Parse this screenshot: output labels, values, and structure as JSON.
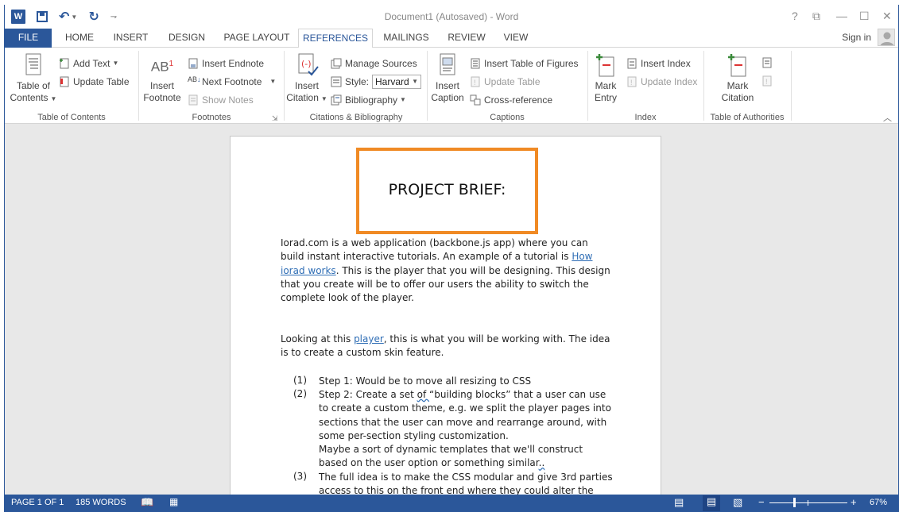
{
  "window": {
    "title": "Document1 (Autosaved) - Word",
    "help": "?",
    "controls": [
      "⧉",
      "—",
      "☐",
      "✕"
    ]
  },
  "qat": {
    "app_icon": "word-icon",
    "save": "save-icon",
    "undo": "undo-icon",
    "redo": "redo-icon",
    "customize": "⇁"
  },
  "tabs": [
    "FILE",
    "HOME",
    "INSERT",
    "DESIGN",
    "PAGE LAYOUT",
    "REFERENCES",
    "MAILINGS",
    "REVIEW",
    "VIEW"
  ],
  "active_tab": "REFERENCES",
  "account": {
    "sign_in": "Sign in"
  },
  "ribbon": {
    "toc": {
      "group": "Table of Contents",
      "toc_line1": "Table of",
      "toc_line2": "Contents",
      "add_text": "Add Text",
      "update_table": "Update Table"
    },
    "footnotes": {
      "group": "Footnotes",
      "insert_footnote_line1": "Insert",
      "insert_footnote_line2": "Footnote",
      "insert_endnote": "Insert Endnote",
      "next_footnote": "Next Footnote",
      "show_notes": "Show Notes",
      "ab_label": "AB",
      "ab_sup": "1"
    },
    "citations": {
      "group": "Citations & Bibliography",
      "insert_citation_line1": "Insert",
      "insert_citation_line2": "Citation",
      "manage_sources": "Manage Sources",
      "style_label": "Style:",
      "style_value": "Harvard",
      "bibliography": "Bibliography"
    },
    "captions": {
      "group": "Captions",
      "insert_caption_line1": "Insert",
      "insert_caption_line2": "Caption",
      "insert_table_of_figures": "Insert Table of Figures",
      "update_table": "Update Table",
      "cross_reference": "Cross-reference"
    },
    "index": {
      "group": "Index",
      "mark_entry_line1": "Mark",
      "mark_entry_line2": "Entry",
      "insert_index": "Insert Index",
      "update_index": "Update Index"
    },
    "authorities": {
      "group": "Table of Authorities",
      "mark_citation_line1": "Mark",
      "mark_citation_line2": "Citation"
    }
  },
  "document": {
    "title": "PROJECT BRIEF:",
    "p1": {
      "a": "Iorad.com is a web application (backbone.js app) where you can build instant interactive tutorials.  An example of a tutorial is ",
      "link": "How iorad works",
      "b": ". This is the player that you will be designing.  This design that you create will be to offer our users the ability to switch the complete look of the player."
    },
    "p2": {
      "a": "Looking at this ",
      "link": "player",
      "b": ", this is what you will be working with.  The idea is to create a custom skin feature."
    },
    "list": [
      {
        "num": "(1)",
        "text": "Step 1: Would be to move all resizing to CSS"
      },
      {
        "num": "(2)",
        "text_a": "Step 2: Create a set ",
        "text_sq": "of ",
        "text_b": " “building blocks” that a user can use to create a custom theme, e.g. we split the player pages into sections that the user can move and rearrange around, with some per-section styling customization.",
        "text_c": "Maybe a sort of dynamic templates that we'll construct based on the user option or something similar",
        "text_c_sq": ".."
      },
      {
        "num": "(3)",
        "text": "The full idea is to make the CSS modular and give 3rd parties access to this on the front end where they could alter the look"
      }
    ]
  },
  "status": {
    "page": "PAGE 1 OF 1",
    "words": "185 WORDS",
    "zoom": "67%",
    "zoom_level": 0.67
  },
  "colors": {
    "accent": "#2b579a",
    "title_box": "#f08a24",
    "link": "#2e6db5"
  }
}
